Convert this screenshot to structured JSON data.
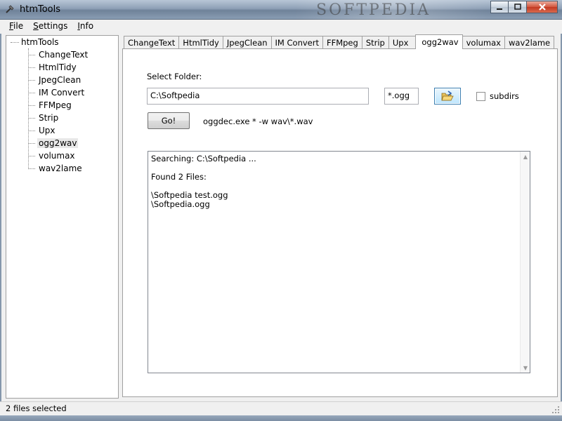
{
  "window": {
    "title": "htmTools",
    "watermark": "SOFTPEDIA",
    "minimize_icon": "minimize-icon",
    "maximize_icon": "maximize-icon",
    "close_icon": "close-icon"
  },
  "menu": {
    "items": [
      "File",
      "Settings",
      "Info"
    ]
  },
  "tree": {
    "root": "htmTools",
    "items": [
      "ChangeText",
      "HtmlTidy",
      "JpegClean",
      "IM Convert",
      "FFMpeg",
      "Strip",
      "Upx",
      "ogg2wav",
      "volumax",
      "wav2lame"
    ],
    "selected": "ogg2wav"
  },
  "tabs": {
    "items": [
      "ChangeText",
      "HtmlTidy",
      "JpegClean",
      "IM Convert",
      "FFMpeg",
      "Strip",
      "Upx",
      "ogg2wav",
      "volumax",
      "wav2lame"
    ],
    "active": "ogg2wav"
  },
  "panel": {
    "select_folder_label": "Select Folder:",
    "folder_value": "C:\\Softpedia",
    "mask_value": "*.ogg",
    "browse_icon": "folder-open-icon",
    "subdirs_label": "subdirs",
    "subdirs_checked": false,
    "go_label": "Go!",
    "command": "oggdec.exe * -w wav\\*.wav",
    "output_lines": [
      "Searching: C:\\Softpedia ...",
      "",
      "Found 2 Files:",
      "",
      "\\Softpedia test.ogg",
      "\\Softpedia.ogg"
    ]
  },
  "status": {
    "text": "2 files selected"
  }
}
